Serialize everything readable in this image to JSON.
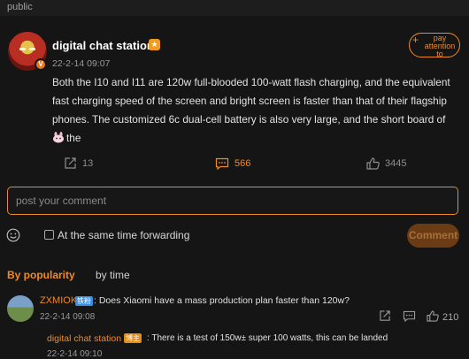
{
  "header": {
    "label": "public"
  },
  "post": {
    "author": "digital chat station",
    "author_badge": "V",
    "time": "22-2-14 09:07",
    "follow": {
      "plus": "+",
      "label": "pay attention to"
    },
    "body_text": "Both the I10 and I11 are 120w full-blooded 100-watt flash charging, and the equivalent fast charging speed of the screen and bright screen is faster than that of their flagship phones. The customized 6c dual-cell battery is also very large, and the short board of ",
    "body_tail": "the",
    "stats": {
      "forward": "13",
      "comments": "566",
      "likes": "3445"
    }
  },
  "composer": {
    "placeholder": "post your comment",
    "forward_label": "At the same time forwarding",
    "submit_label": "Comment"
  },
  "tabs": {
    "popularity": "By popularity",
    "time": "by time"
  },
  "comments": [
    {
      "user": "ZXMIOK",
      "badge": "铁粉",
      "text": ": Does Xiaomi have a mass production plan faster than 120w?",
      "time": "22-2-14 09:08",
      "likes": "210",
      "reply": {
        "user": "digital chat station",
        "badge": "博主",
        "text": ": There is a test of 150w± super 100 watts, this can be landed",
        "time": "22-2-14 09:10"
      }
    }
  ],
  "colors": {
    "accent": "#f08a24",
    "background": "#151515",
    "badge_blue": "#3a8de0"
  },
  "icons": [
    "forward-icon",
    "comment-icon",
    "like-icon",
    "emoji-icon"
  ]
}
